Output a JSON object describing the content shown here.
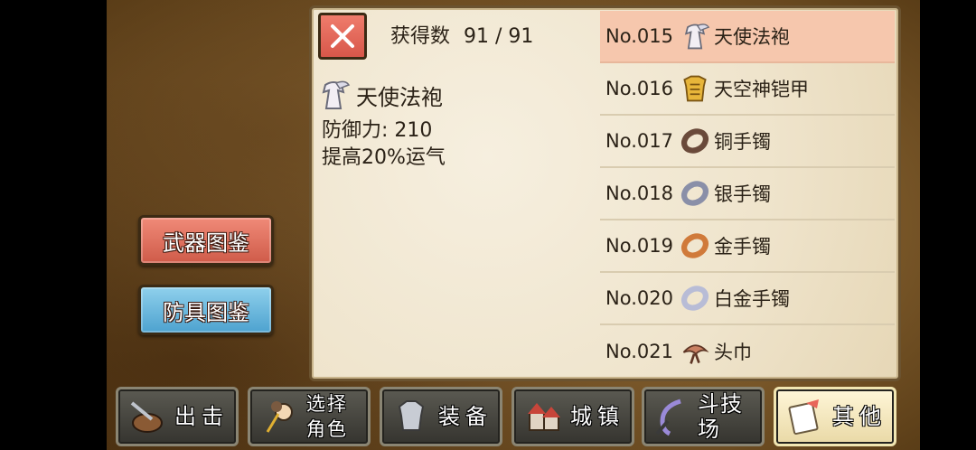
{
  "header": {
    "got_label": "获得数",
    "got_count": "91 / 91"
  },
  "categories": {
    "weapon": "武器图鉴",
    "armor": "防具图鉴"
  },
  "detail": {
    "name": "天使法袍",
    "defense": "防御力: 210",
    "effect": "提高20%运气",
    "icon": "angel-robe-icon"
  },
  "items": [
    {
      "no": "No.015",
      "name": "天使法袍",
      "icon": "angel-robe-icon",
      "selected": true
    },
    {
      "no": "No.016",
      "name": "天空神铠甲",
      "icon": "sky-god-armor-icon"
    },
    {
      "no": "No.017",
      "name": "铜手镯",
      "icon": "bronze-bracelet-icon"
    },
    {
      "no": "No.018",
      "name": "银手镯",
      "icon": "silver-bracelet-icon"
    },
    {
      "no": "No.019",
      "name": "金手镯",
      "icon": "gold-bracelet-icon"
    },
    {
      "no": "No.020",
      "name": "白金手镯",
      "icon": "platinum-bracelet-icon"
    },
    {
      "no": "No.021",
      "name": "头巾",
      "icon": "bandana-icon"
    }
  ],
  "tabs": [
    {
      "label": "出击",
      "icon": "sortie-icon"
    },
    {
      "label": "选择\n角色",
      "icon": "select-character-icon"
    },
    {
      "label": "装备",
      "icon": "equipment-icon"
    },
    {
      "label": "城镇",
      "icon": "town-icon"
    },
    {
      "label": "斗技场",
      "icon": "arena-icon"
    },
    {
      "label": "其他",
      "icon": "other-icon",
      "active": true
    }
  ],
  "colors": {
    "selected_row": "#f6c7ad",
    "weapon_button": "#e2705f",
    "armor_button": "#6cb9e0",
    "close_button": "#e0695a"
  }
}
